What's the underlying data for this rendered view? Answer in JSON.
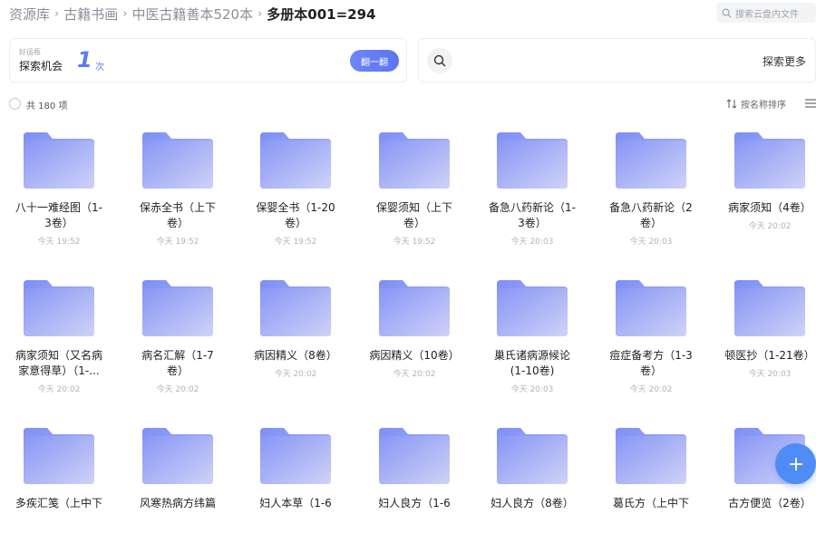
{
  "breadcrumb": {
    "items": [
      "资源库",
      "古籍书画",
      "中医古籍善本520本"
    ],
    "separator": "›",
    "current": "多册本001=294"
  },
  "search": {
    "placeholder": "搜索云盘内文件"
  },
  "promo_card": {
    "small_label": "好运瓶",
    "label": "探索机会",
    "count": "1",
    "unit": "次",
    "button": "翻一翻"
  },
  "explore_card": {
    "label": "探索更多"
  },
  "list_header": {
    "count_text": "共 180 项",
    "sort_label": "按名称排序"
  },
  "folders": [
    {
      "name_l1": "八十一难经图（1-",
      "name_l2": "3卷）",
      "time": "今天 19:52"
    },
    {
      "name_l1": "保赤全书（上下",
      "name_l2": "卷）",
      "time": "今天 19:52"
    },
    {
      "name_l1": "保婴全书（1-20",
      "name_l2": "卷）",
      "time": "今天 19:52"
    },
    {
      "name_l1": "保婴须知（上下",
      "name_l2": "卷）",
      "time": "今天 19:52"
    },
    {
      "name_l1": "备急八药新论（1-",
      "name_l2": "3卷）",
      "time": "今天 20:03"
    },
    {
      "name_l1": "备急八药新论（2",
      "name_l2": "卷）",
      "time": "今天 20:03"
    },
    {
      "name_l1": "病家须知（4卷）",
      "name_l2": "",
      "time": "今天 20:02"
    },
    {
      "name_l1": "病家须知（又名病",
      "name_l2": "家意得草）（1-...",
      "time": "今天 20:02"
    },
    {
      "name_l1": "病名汇解（1-7",
      "name_l2": "卷）",
      "time": "今天 20:02"
    },
    {
      "name_l1": "病因精义（8卷）",
      "name_l2": "",
      "time": "今天 20:02"
    },
    {
      "name_l1": "病因精义（10卷）",
      "name_l2": "",
      "time": "今天 20:02"
    },
    {
      "name_l1": "巢氏诸病源候论",
      "name_l2": "(1-10卷)",
      "time": "今天 20:03"
    },
    {
      "name_l1": "痘症备考方（1-3",
      "name_l2": "卷）",
      "time": "今天 20:02"
    },
    {
      "name_l1": "顿医抄（1-21卷）",
      "name_l2": "",
      "time": "今天 20:03"
    },
    {
      "name_l1": "多疾汇笺（上中下",
      "name_l2": "",
      "time": ""
    },
    {
      "name_l1": "风寒热病方纬篇",
      "name_l2": "",
      "time": ""
    },
    {
      "name_l1": "妇人本草（1-6",
      "name_l2": "",
      "time": ""
    },
    {
      "name_l1": "妇人良方（1-6",
      "name_l2": "",
      "time": ""
    },
    {
      "name_l1": "妇人良方（8卷）",
      "name_l2": "",
      "time": ""
    },
    {
      "name_l1": "葛氏方（上中下",
      "name_l2": "",
      "time": ""
    },
    {
      "name_l1": "古方便览（2卷）",
      "name_l2": "",
      "time": ""
    }
  ],
  "colors": {
    "accent": "#5b7cf5",
    "folder_light": "#c5c9f5",
    "folder_dark": "#7b8ef4",
    "fab": "#4f8cf6"
  }
}
